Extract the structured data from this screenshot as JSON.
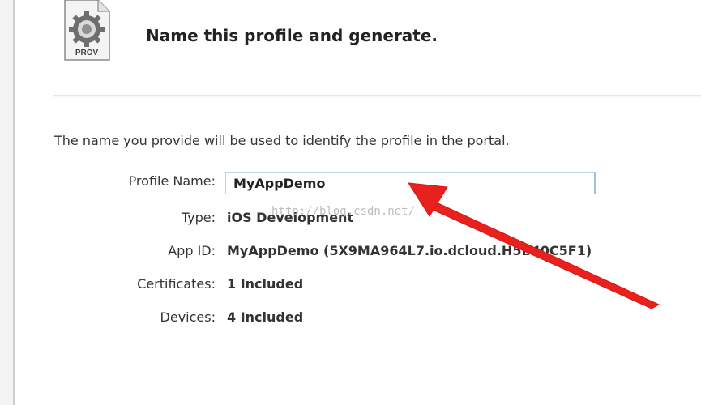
{
  "icon": {
    "name": "provisioning-profile-icon",
    "label": "PROV"
  },
  "header": {
    "title": "Name this profile and generate."
  },
  "intro_text": "The name you provide will be used to identify the profile in the portal.",
  "form": {
    "profile_name": {
      "label": "Profile Name:",
      "value": "MyAppDemo"
    },
    "type": {
      "label": "Type:",
      "value": "iOS Development"
    },
    "app_id": {
      "label": "App ID:",
      "value": "MyAppDemo (5X9MA964L7.io.dcloud.H5B40C5F1)"
    },
    "certificates": {
      "label": "Certificates:",
      "value": "1 Included"
    },
    "devices": {
      "label": "Devices:",
      "value": "4 Included"
    }
  },
  "watermark": "http://blog.csdn.net/",
  "colors": {
    "annotation_arrow": "#e8201e",
    "input_border": "#9fbfe0"
  }
}
